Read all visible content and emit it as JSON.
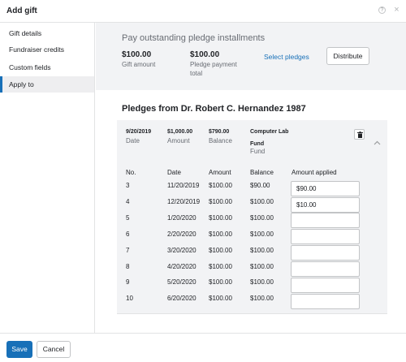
{
  "dialog": {
    "title": "Add gift",
    "help_icon": "question-circle-icon",
    "close_icon": "close-icon"
  },
  "sidebar": {
    "items": [
      {
        "label": "Gift details",
        "active": false
      },
      {
        "label": "Fundraiser credits",
        "active": false
      },
      {
        "label": "Custom fields",
        "active": false
      },
      {
        "label": "Apply to",
        "active": true
      }
    ]
  },
  "summary": {
    "title": "Pay outstanding pledge installments",
    "gift_amount": "$100.00",
    "gift_amount_label": "Gift amount",
    "pledge_payment_total": "$100.00",
    "pledge_payment_total_label_1": "Pledge payment",
    "pledge_payment_total_label_2": "total",
    "select_pledges_link": "Select pledges",
    "distribute_button": "Distribute"
  },
  "pledges": {
    "title": "Pledges from Dr. Robert C. Hernandez 1987",
    "header": {
      "date_value": "9/20/2019",
      "date_label": "Date",
      "amount_value": "$1,000.00",
      "amount_label": "Amount",
      "balance_value": "$790.00",
      "balance_label": "Balance",
      "fund_value_1": "Computer Lab",
      "fund_value_2": "Fund",
      "fund_label": "Fund"
    },
    "columns": [
      "No.",
      "Date",
      "Amount",
      "Balance",
      "Amount applied"
    ],
    "rows": [
      {
        "no": "3",
        "date": "11/20/2019",
        "amount": "$100.00",
        "balance": "$90.00",
        "applied": "$90.00"
      },
      {
        "no": "4",
        "date": "12/20/2019",
        "amount": "$100.00",
        "balance": "$100.00",
        "applied": "$10.00"
      },
      {
        "no": "5",
        "date": "1/20/2020",
        "amount": "$100.00",
        "balance": "$100.00",
        "applied": ""
      },
      {
        "no": "6",
        "date": "2/20/2020",
        "amount": "$100.00",
        "balance": "$100.00",
        "applied": ""
      },
      {
        "no": "7",
        "date": "3/20/2020",
        "amount": "$100.00",
        "balance": "$100.00",
        "applied": ""
      },
      {
        "no": "8",
        "date": "4/20/2020",
        "amount": "$100.00",
        "balance": "$100.00",
        "applied": ""
      },
      {
        "no": "9",
        "date": "5/20/2020",
        "amount": "$100.00",
        "balance": "$100.00",
        "applied": ""
      },
      {
        "no": "10",
        "date": "6/20/2020",
        "amount": "$100.00",
        "balance": "$100.00",
        "applied": ""
      }
    ],
    "delete_icon": "trash-icon",
    "collapse_icon": "chevron-up-icon"
  },
  "footer": {
    "save_label": "Save",
    "cancel_label": "Cancel"
  },
  "colors": {
    "accent": "#1870b8",
    "panel_bg": "#f2f3f5",
    "border": "#c2c4c6"
  }
}
